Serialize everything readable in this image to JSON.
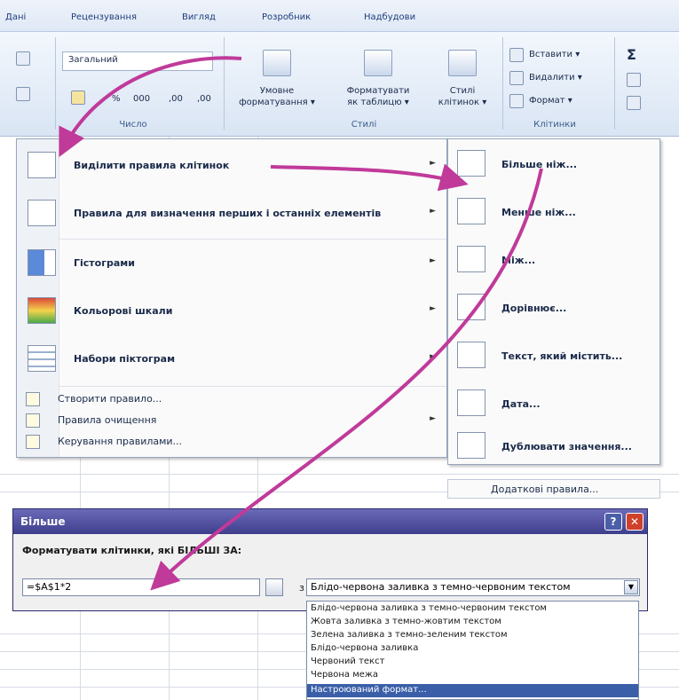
{
  "ribbon": {
    "tabs": [
      "Дані",
      "Рецензування",
      "Вигляд",
      "Розробник",
      "Надбудови"
    ],
    "number_format_value": "Загальний",
    "number_buttons": [
      "%",
      "000",
      ",00",
      ",00"
    ],
    "groups": {
      "number": "Число",
      "styles": "Стилі",
      "cells": "Клітинки"
    },
    "styles_buttons": {
      "conditional": [
        "Умовне",
        "форматування ▾"
      ],
      "as_table": [
        "Форматувати",
        "як таблицю ▾"
      ],
      "cell_styles": [
        "Стилі",
        "клітинок ▾"
      ]
    },
    "cells_commands": [
      "Вставити ▾",
      "Видалити ▾",
      "Формат ▾"
    ],
    "sigma": "Σ",
    "colors": {
      "accent": "#c03a9a",
      "tab_bg": "#dfe8f5",
      "dialog_title": "#4a4a9a",
      "close": "#d0402a"
    }
  },
  "menu": {
    "items": [
      {
        "label": "Виділити правила клітинок",
        "icon": "highlight-rules-icon"
      },
      {
        "label": "Правила для визначення перших і останніх елементів",
        "icon": "top-bottom-icon"
      },
      {
        "label": "Гістограми",
        "icon": "data-bars-icon"
      },
      {
        "label": "Кольорові шкали",
        "icon": "color-scales-icon"
      },
      {
        "label": "Набори піктограм",
        "icon": "icon-sets-icon"
      }
    ],
    "small_items": [
      {
        "label": "Створити правило..."
      },
      {
        "label": "Правила очищення"
      },
      {
        "label": "Керування правилами..."
      }
    ]
  },
  "submenu": {
    "items": [
      {
        "label": "Більше ніж..."
      },
      {
        "label": "Менше ніж..."
      },
      {
        "label": "Між..."
      },
      {
        "label": "Дорівнює..."
      },
      {
        "label": "Текст, який містить..."
      },
      {
        "label": "Дата..."
      },
      {
        "label": "Дублювати значення..."
      }
    ],
    "more": "Додаткові правила..."
  },
  "dialog": {
    "title": "Більше",
    "help": "?",
    "close": "✕",
    "prompt": "Форматувати клітинки, які БІЛЬШІ ЗА:",
    "input_value": "=$A$1*2",
    "connector": "з",
    "format_value": "Блідо-червона заливка з темно-червоним текстом",
    "options": [
      "Блідо-червона заливка з темно-червоним текстом",
      "Жовта заливка з темно-жовтим текстом",
      "Зелена заливка з темно-зеленим текстом",
      "Блідо-червона заливка",
      "Червоний текст",
      "Червона межа",
      "Настроюваний формат..."
    ],
    "selected_option": 6
  }
}
